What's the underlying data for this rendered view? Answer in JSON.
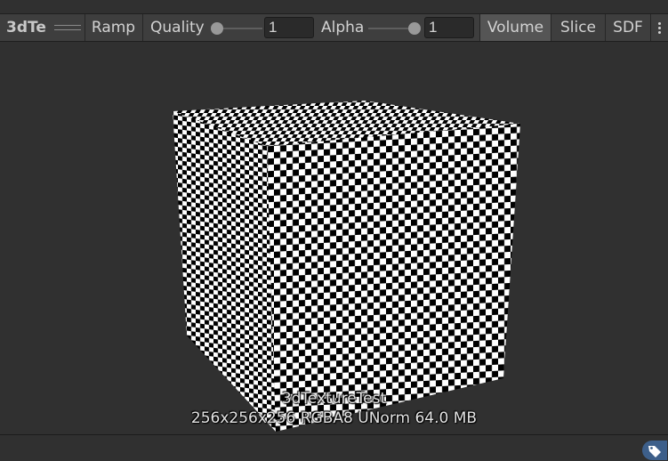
{
  "toolbar": {
    "title": "3dTe",
    "ramp_label": "Ramp",
    "quality_label": "Quality",
    "quality_value": "1",
    "quality_slider_fraction": 0.0,
    "alpha_label": "Alpha",
    "alpha_value": "1",
    "alpha_slider_fraction": 1.0,
    "volume_label": "Volume",
    "slice_label": "Slice",
    "sdf_label": "SDF",
    "active_mode": "Volume",
    "more_icon": "kebab-menu-icon"
  },
  "preview": {
    "asset_name": "3dTextureTest",
    "info": "256x256x256 RGBA8 UNorm 64.0 MB"
  },
  "statusbar": {
    "tag_icon": "tag-icon"
  },
  "colors": {
    "background": "#303030",
    "toolbar": "#3e3e3e",
    "active_button": "#555555",
    "tag_button": "#3d5f8a",
    "checker_dark": "#000000",
    "checker_light": "#ffffff"
  }
}
